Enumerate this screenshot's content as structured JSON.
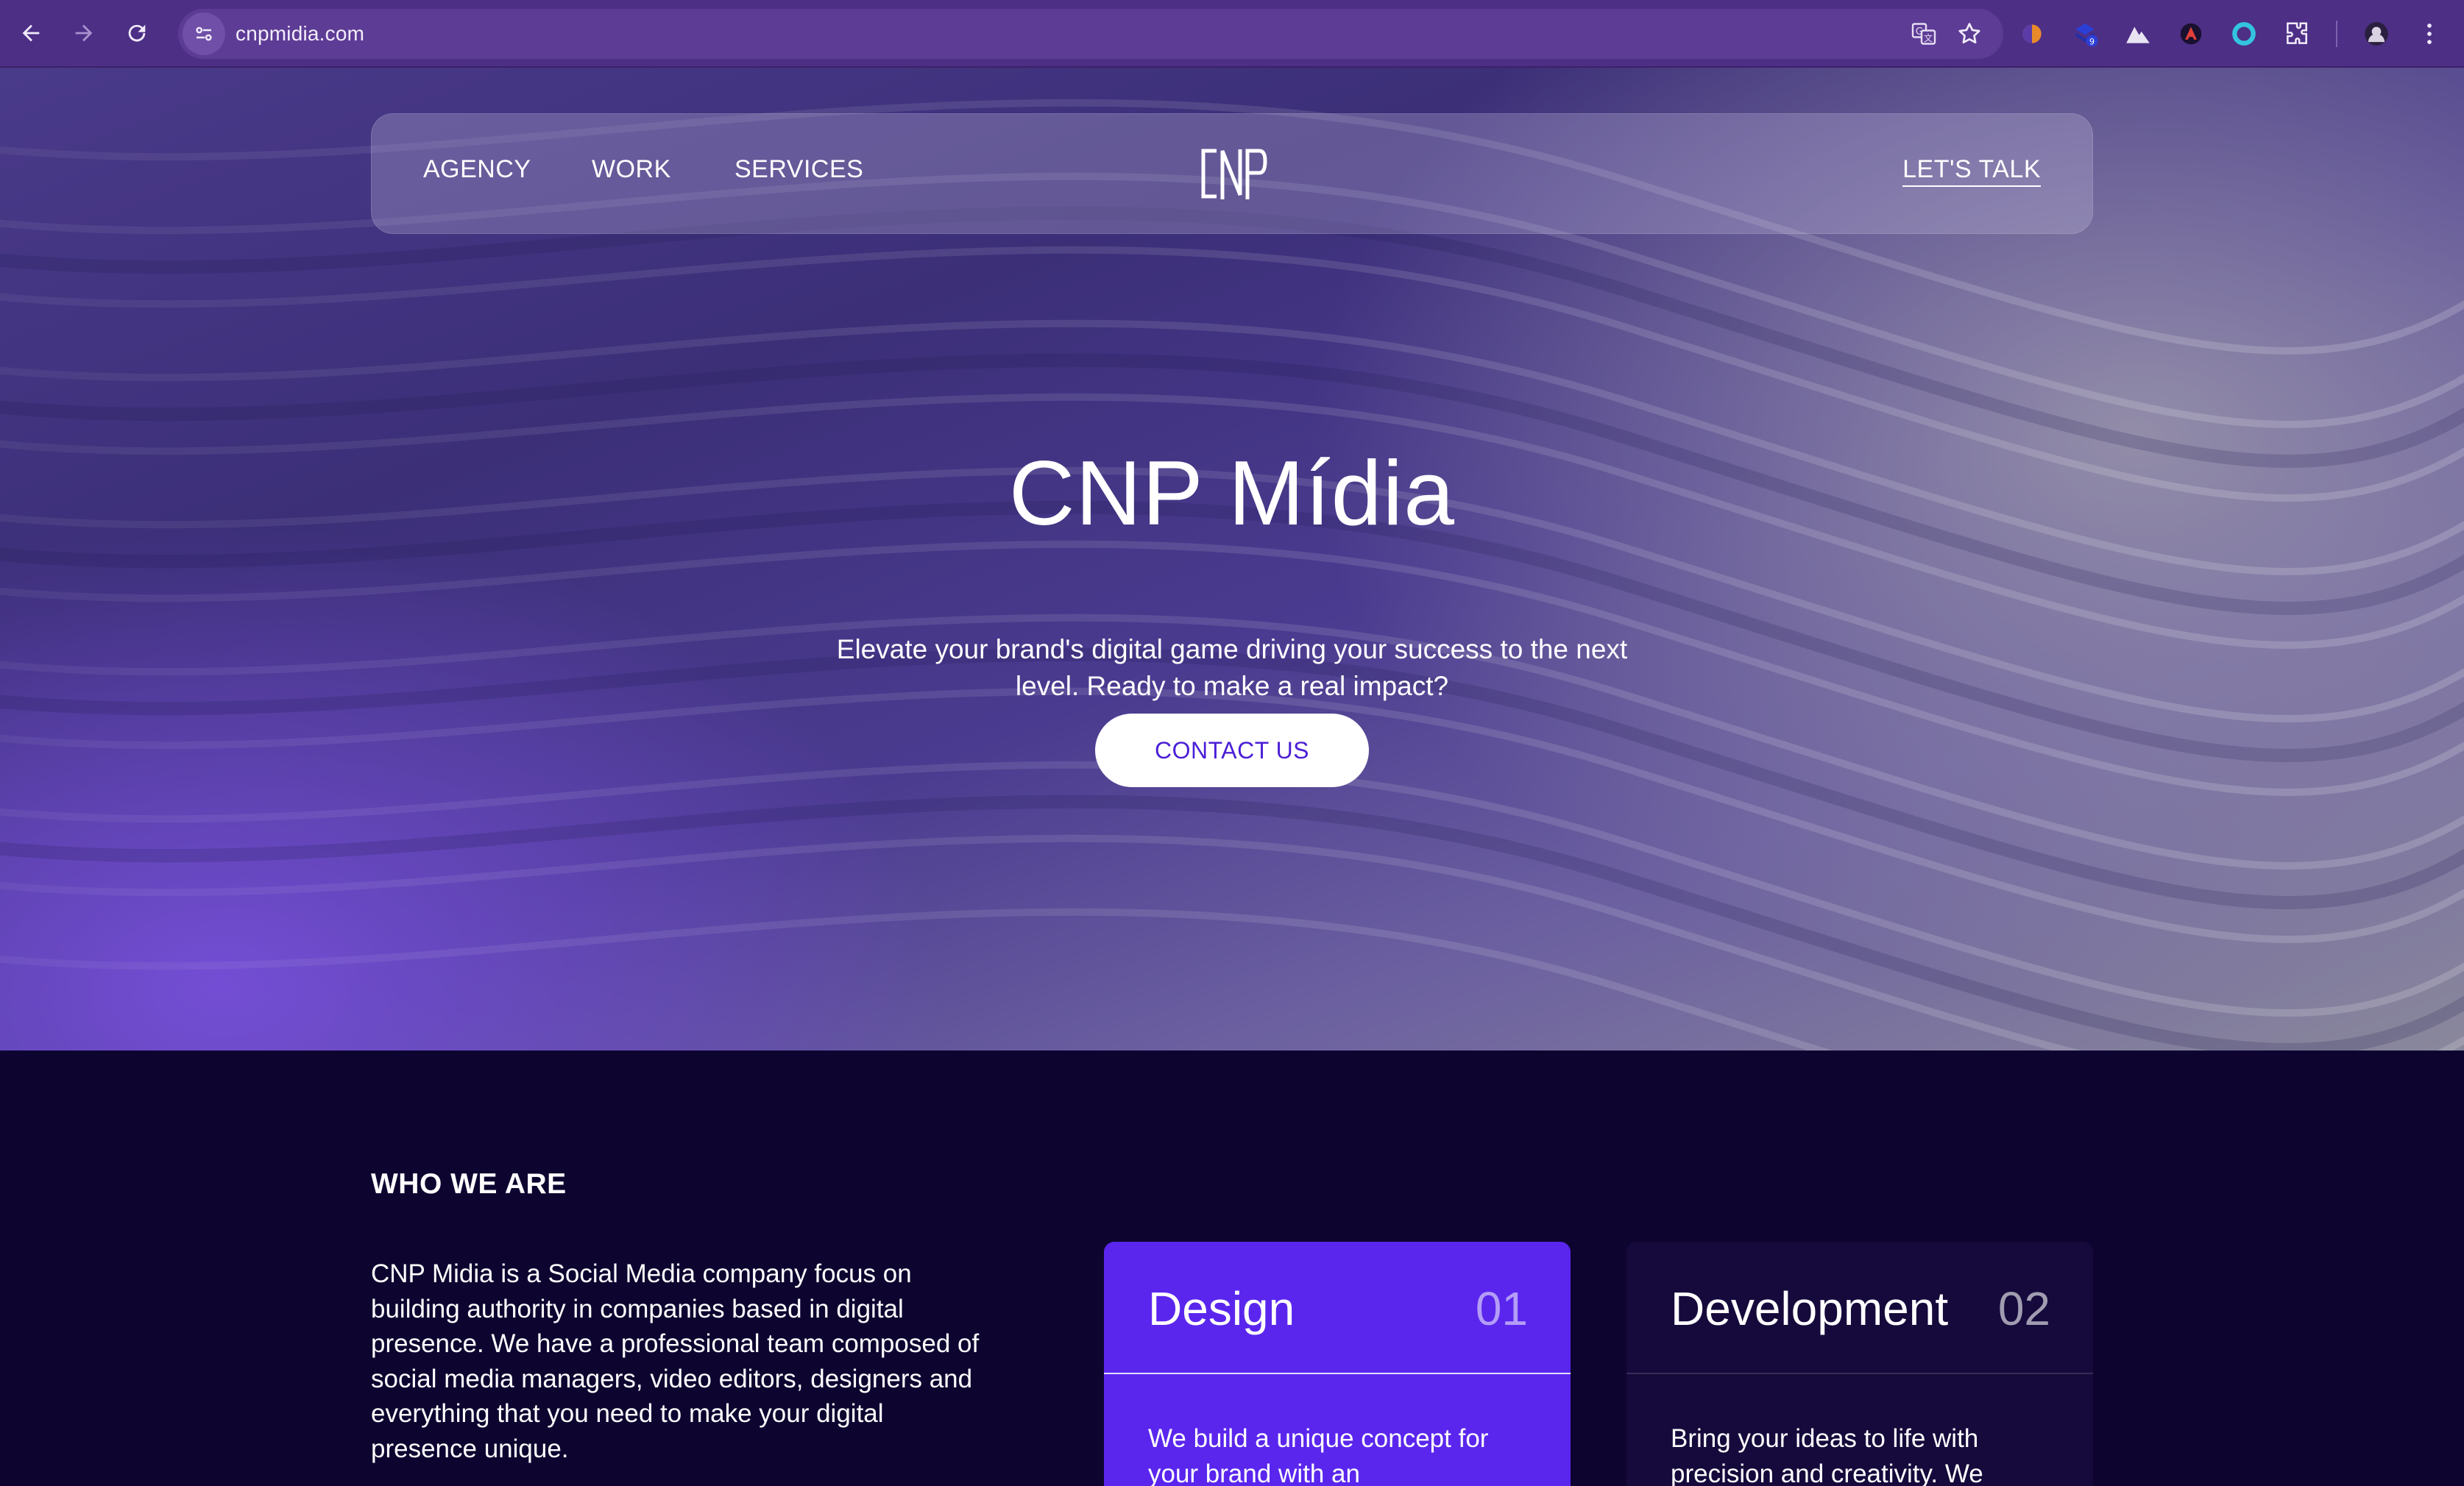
{
  "browser": {
    "url": "cnpmidia.com",
    "icons": [
      "back-icon",
      "forward-icon",
      "reload-icon",
      "site-info-icon",
      "translate-icon",
      "bookmark-star-icon",
      "extensions-icon",
      "profile-avatar",
      "more-menu-icon"
    ],
    "extension_badge": "9"
  },
  "nav": {
    "links": [
      "AGENCY",
      "WORK",
      "SERVICES"
    ],
    "cta": "LET'S TALK"
  },
  "hero": {
    "title": "CNP Mídia",
    "subtitle": "Elevate your brand's digital game driving your success to the next level. Ready to make a real impact?",
    "button": "CONTACT US"
  },
  "who": {
    "title": "WHO WE ARE",
    "text": "CNP Midia is a Social Media company focus on building authority in companies based in digital presence. We have a professional team composed of social media managers, video editors, designers and everything that you need to make your digital presence unique."
  },
  "cards": [
    {
      "name": "Design",
      "number": "01",
      "text": "We build a unique concept for your brand with an"
    },
    {
      "name": "Development",
      "number": "02",
      "text": "Bring your ideas to life with precision and creativity. We"
    }
  ],
  "colors": {
    "chrome": "#4d2f86",
    "accent": "#5a26ee",
    "section_bg": "#0d0530",
    "cta_text": "#4b1fd6"
  }
}
